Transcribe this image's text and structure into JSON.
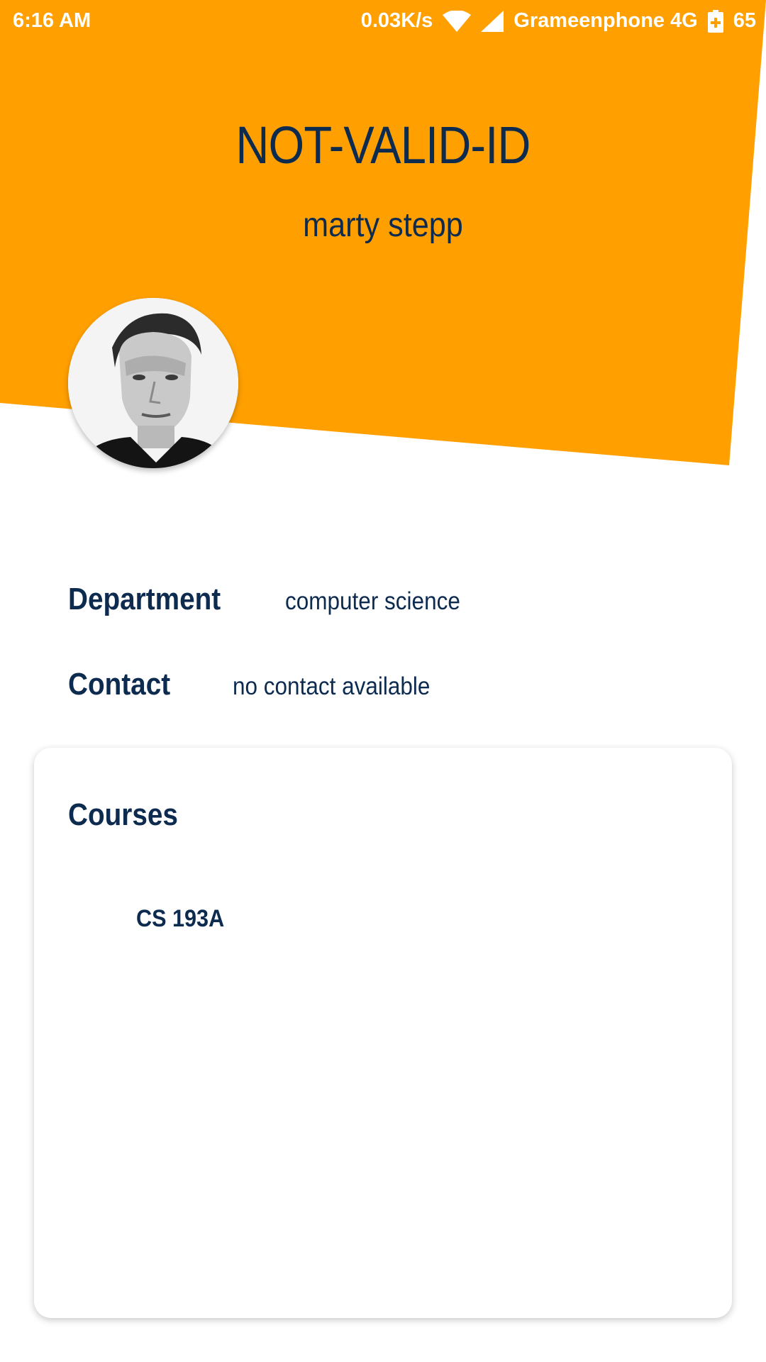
{
  "status_bar": {
    "time": "6:16 AM",
    "network_speed": "0.03K/s",
    "carrier": "Grameenphone 4G",
    "battery": "65",
    "icons": [
      "wifi-icon",
      "cell-signal-icon",
      "battery-charging-icon"
    ]
  },
  "header": {
    "id": "NOT-VALID-ID",
    "name": "marty stepp",
    "accent_color": "#ffa000",
    "avatar_icon": "profile-photo"
  },
  "info": {
    "department_label": "Department",
    "department_value": "computer science",
    "contact_label": "Contact",
    "contact_value": "no contact available"
  },
  "courses": {
    "title": "Courses",
    "items": [
      "CS 193A"
    ]
  },
  "colors": {
    "text": "#0d2a4f",
    "accent": "#ffa000",
    "background": "#ffffff"
  }
}
